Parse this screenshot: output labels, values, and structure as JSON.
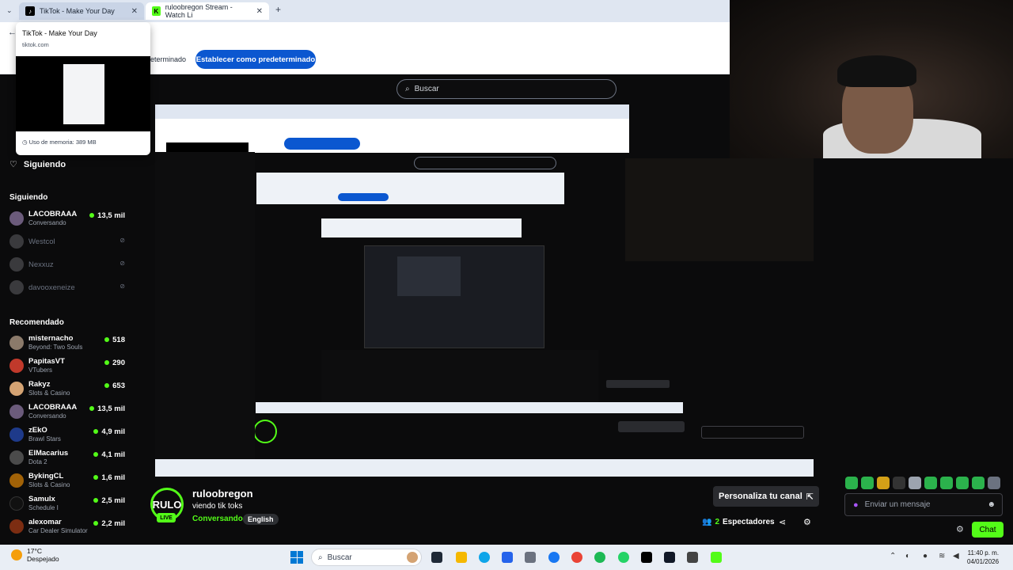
{
  "browser": {
    "tabs": [
      {
        "title": "TikTok - Make Your Day"
      },
      {
        "title": "ruloobregon Stream - Watch Li"
      }
    ],
    "new_tab": "+",
    "banner_text": "eterminado",
    "set_default_button": "Establecer como predeterminado",
    "preview": {
      "title": "TikTok - Make Your Day",
      "url": "tiktok.com",
      "memory": "Uso de memoria: 389 MB"
    }
  },
  "kick": {
    "search_placeholder": "Buscar",
    "siguiendo_header": "Siguiendo",
    "following_title": "Siguiendo",
    "recommended_title": "Recomendado",
    "following": [
      {
        "name": "LACOBRAAA",
        "sub": "Conversando",
        "viewers": "13,5 mil",
        "online": true
      },
      {
        "name": "Westcol",
        "online": false
      },
      {
        "name": "Nexxuz",
        "online": false
      },
      {
        "name": "davooxeneize",
        "online": false
      }
    ],
    "recommended": [
      {
        "name": "misternacho",
        "sub": "Beyond: Two Souls",
        "viewers": "518"
      },
      {
        "name": "PapitasVT",
        "sub": "VTubers",
        "viewers": "290"
      },
      {
        "name": "Rakyz",
        "sub": "Slots & Casino",
        "viewers": "653"
      },
      {
        "name": "LACOBRAAA",
        "sub": "Conversando",
        "viewers": "13,5 mil"
      },
      {
        "name": "zEkO",
        "sub": "Brawl Stars",
        "viewers": "4,9 mil"
      },
      {
        "name": "ElMacarius",
        "sub": "Dota 2",
        "viewers": "4,1 mil"
      },
      {
        "name": "BykingCL",
        "sub": "Slots & Casino",
        "viewers": "1,6 mil"
      },
      {
        "name": "Samulx",
        "sub": "Schedule I",
        "viewers": "2,5 mil"
      },
      {
        "name": "alexomar",
        "sub": "Car Dealer Simulator",
        "viewers": "2,2 mil"
      }
    ],
    "stream": {
      "logo_text": "RULO",
      "live_badge": "LIVE",
      "streamer": "ruloobregon",
      "title": "viendo tik toks",
      "category": "Conversando",
      "language": "English",
      "customize_button": "Personaliza tu canal",
      "viewers_count": "2",
      "viewers_label": "Espectadores"
    },
    "chat": {
      "input_placeholder": "Enviar un mensaje",
      "send_button": "Chat"
    }
  },
  "taskbar": {
    "weather_temp": "17°C",
    "weather_desc": "Despejado",
    "search_placeholder": "Buscar",
    "time": "11:40 p. m.",
    "date": "04/01/2026"
  },
  "colors": {
    "kick_green": "#53fc18",
    "chrome_blue": "#0b57d0",
    "background": "#0b0b0c"
  }
}
